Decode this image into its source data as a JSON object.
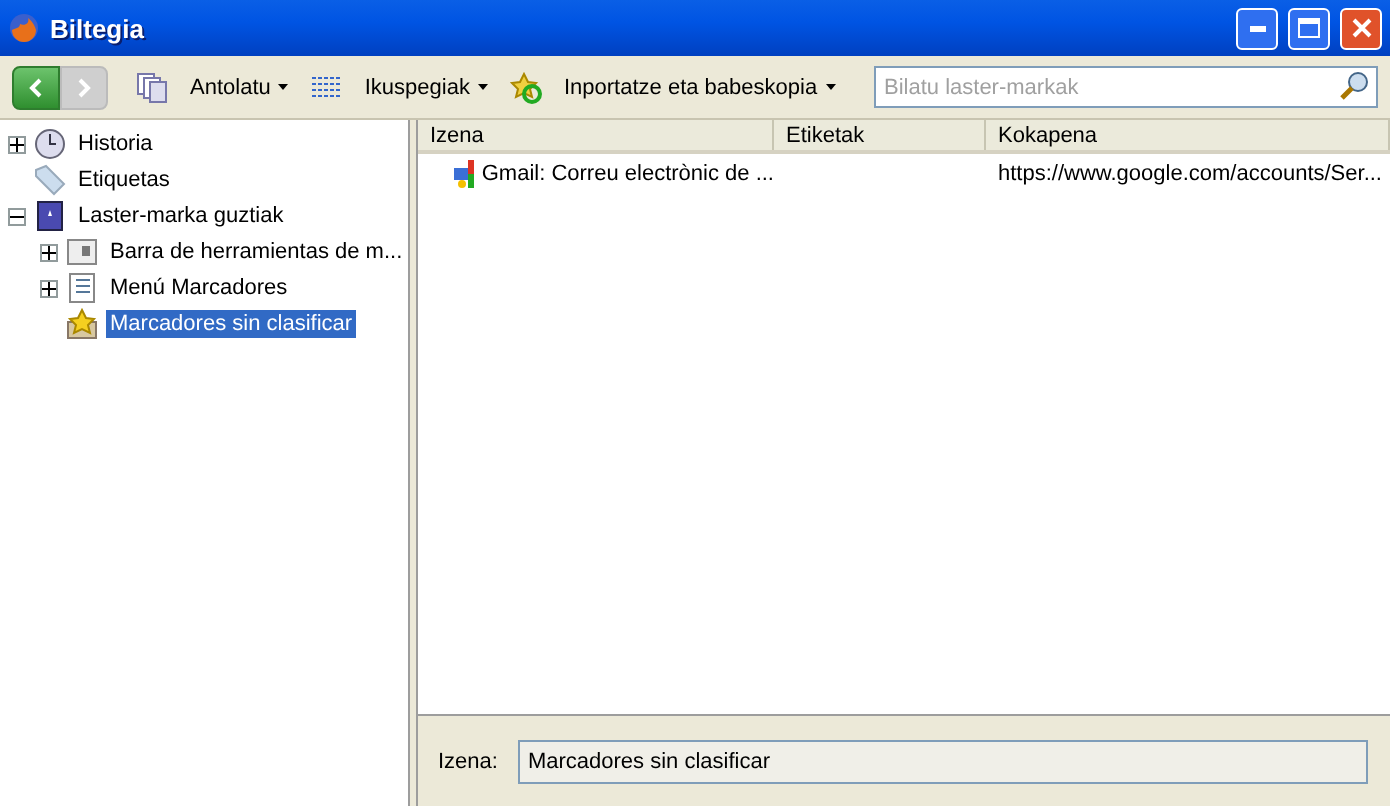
{
  "window": {
    "title": "Biltegia"
  },
  "toolbar": {
    "back": {
      "disabled": false
    },
    "forward": {
      "disabled": true
    },
    "menus": [
      {
        "label": "Antolatu",
        "kind": "organize"
      },
      {
        "label": "Ikuspegiak",
        "kind": "views"
      },
      {
        "label": "Inportatze eta babeskopia",
        "kind": "import"
      }
    ],
    "search": {
      "placeholder": "Bilatu laster-markak"
    }
  },
  "sidebar": {
    "items": [
      {
        "label": "Historia",
        "kind": "history",
        "expanded": false,
        "selected": false
      },
      {
        "label": "Etiquetas",
        "kind": "tags",
        "selected": false
      },
      {
        "label": "Laster-marka guztiak",
        "kind": "all",
        "expanded": true,
        "selected": false,
        "children": [
          {
            "label": "Barra de herramientas de m...",
            "kind": "toolbar",
            "expanded": false,
            "selected": false
          },
          {
            "label": "Menú Marcadores",
            "kind": "menu",
            "expanded": false,
            "selected": false
          },
          {
            "label": "Marcadores sin clasificar",
            "kind": "unsorted",
            "selected": true
          }
        ]
      }
    ]
  },
  "table": {
    "columns": [
      "Izena",
      "Etiketak",
      "Kokapena"
    ],
    "rows": [
      {
        "name": "Gmail: Correu electrònic de ...",
        "location": "https://www.google.com/accounts/Ser..."
      }
    ]
  },
  "details": {
    "label": "Izena:",
    "value": "Marcadores sin clasificar"
  }
}
